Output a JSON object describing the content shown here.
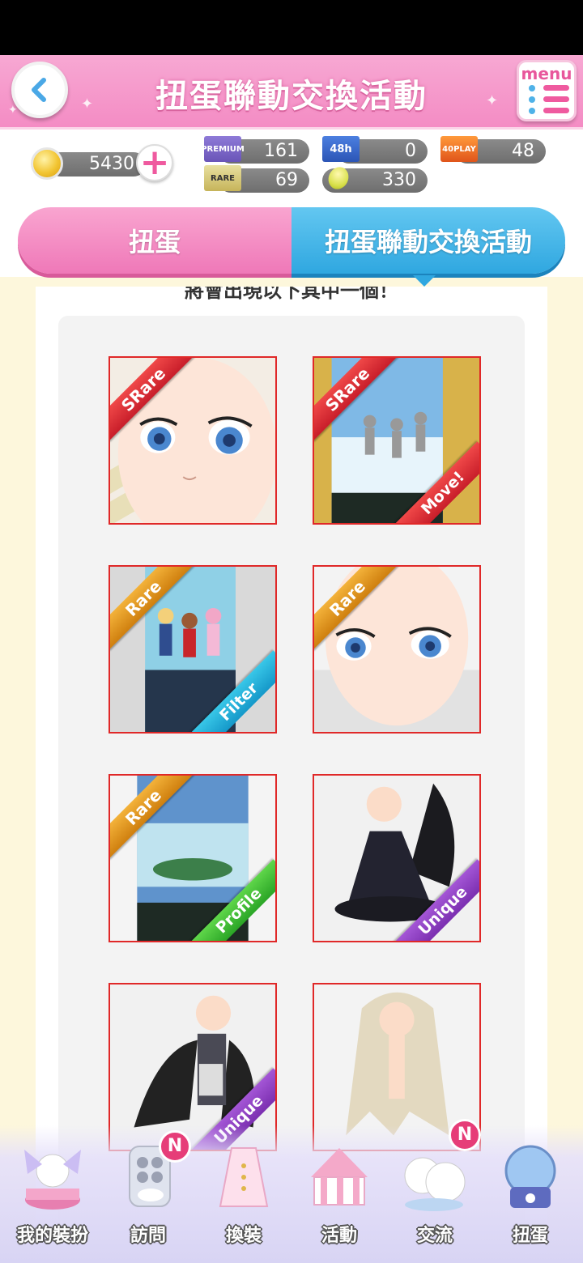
{
  "header": {
    "title": "扭蛋聯動交換活動",
    "menu_label": "menu"
  },
  "currency": {
    "coins": "5430",
    "premium_tickets": "161",
    "ticket_48h": "0",
    "ticket_40play": "48",
    "rare_tickets": "69",
    "lemons": "330",
    "ticket_labels": {
      "premium": "PREMIUM",
      "h48": "48h",
      "play40": "40PLAY",
      "rare": "RARE"
    }
  },
  "tabs": [
    {
      "label": "扭蛋",
      "active": false
    },
    {
      "label": "扭蛋聯動交換活動",
      "active": true
    }
  ],
  "notice": "將會出現以下其中一個！",
  "items": [
    {
      "rarity": "SRare",
      "type": "",
      "kind": "face"
    },
    {
      "rarity": "SRare",
      "type": "Move!",
      "kind": "background"
    },
    {
      "rarity": "Rare",
      "type": "Filter",
      "kind": "filter"
    },
    {
      "rarity": "Rare",
      "type": "",
      "kind": "face"
    },
    {
      "rarity": "Rare",
      "type": "Profile",
      "kind": "background"
    },
    {
      "rarity": "",
      "type": "Unique",
      "kind": "dress"
    },
    {
      "rarity": "",
      "type": "Unique",
      "kind": "outfit"
    },
    {
      "rarity": "",
      "type": "",
      "kind": "hair"
    }
  ],
  "nav": [
    {
      "label": "我的裝扮",
      "badge": ""
    },
    {
      "label": "訪問",
      "badge": "N"
    },
    {
      "label": "換裝",
      "badge": ""
    },
    {
      "label": "活動",
      "badge": ""
    },
    {
      "label": "交流",
      "badge": "N"
    },
    {
      "label": "扭蛋",
      "badge": ""
    }
  ]
}
